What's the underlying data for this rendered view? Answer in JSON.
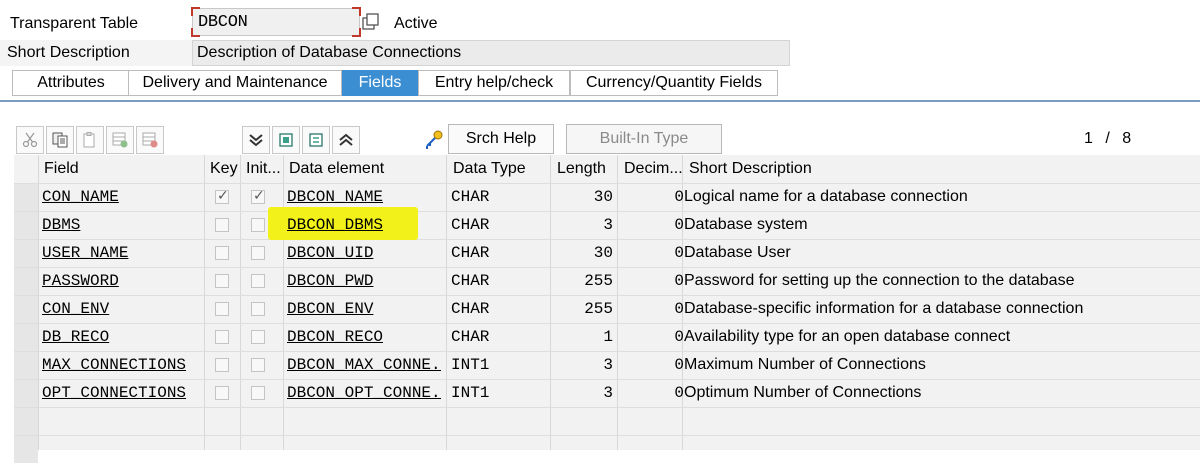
{
  "header": {
    "table_type_label": "Transparent Table",
    "table_name": "DBCON",
    "status": "Active",
    "short_description_label": "Short Description",
    "short_description": "Description of Database Connections"
  },
  "tabs": [
    {
      "label": "Attributes",
      "active": false
    },
    {
      "label": "Delivery and Maintenance",
      "active": false
    },
    {
      "label": "Fields",
      "active": true
    },
    {
      "label": "Entry help/check",
      "active": false
    },
    {
      "label": "Currency/Quantity Fields",
      "active": false
    }
  ],
  "toolbar": {
    "icons": [
      "cut-icon",
      "copy-icon",
      "paste-icon",
      "insert-row-icon",
      "delete-row-icon",
      "collapse-icon",
      "new-rows-icon",
      "expand-icon",
      "scroll-up-icon",
      "key-icon"
    ],
    "search_help_label": "Srch Help",
    "builtin_type_label": "Built-In Type",
    "page_current": "1",
    "page_separator": "/",
    "page_total": "8"
  },
  "table": {
    "columns": [
      "Field",
      "Key",
      "Init...",
      "Data element",
      "Data Type",
      "Length",
      "Decim...",
      "Short Description"
    ],
    "rows": [
      {
        "field": "CON_NAME",
        "key": true,
        "init": true,
        "data_element": "DBCON_NAME",
        "data_type": "CHAR",
        "length": "30",
        "decimals": "0",
        "description": "Logical name for a database connection"
      },
      {
        "field": "DBMS",
        "key": false,
        "init": false,
        "data_element": "DBCON_DBMS",
        "data_type": "CHAR",
        "length": "3",
        "decimals": "0",
        "description": "Database system"
      },
      {
        "field": "USER_NAME",
        "key": false,
        "init": false,
        "data_element": "DBCON_UID",
        "data_type": "CHAR",
        "length": "30",
        "decimals": "0",
        "description": "Database User"
      },
      {
        "field": "PASSWORD",
        "key": false,
        "init": false,
        "data_element": "DBCON_PWD",
        "data_type": "CHAR",
        "length": "255",
        "decimals": "0",
        "description": "Password for setting up the connection to the database"
      },
      {
        "field": "CON_ENV",
        "key": false,
        "init": false,
        "data_element": "DBCON_ENV",
        "data_type": "CHAR",
        "length": "255",
        "decimals": "0",
        "description": "Database-specific information for a database connection"
      },
      {
        "field": "DB_RECO",
        "key": false,
        "init": false,
        "data_element": "DBCON_RECO",
        "data_type": "CHAR",
        "length": "1",
        "decimals": "0",
        "description": "Availability type for an open database connect"
      },
      {
        "field": "MAX_CONNECTIONS",
        "key": false,
        "init": false,
        "data_element": "DBCON_MAX_CONNE...",
        "data_type": "INT1",
        "length": "3",
        "decimals": "0",
        "description": "Maximum Number of Connections"
      },
      {
        "field": "OPT_CONNECTIONS",
        "key": false,
        "init": false,
        "data_element": "DBCON_OPT_CONNE...",
        "data_type": "INT1",
        "length": "3",
        "decimals": "0",
        "description": "Optimum Number of Connections"
      }
    ]
  },
  "colors": {
    "active_tab": "#3c8ed2",
    "highlight": "#f2f21a",
    "required_marker": "#c0392b"
  }
}
